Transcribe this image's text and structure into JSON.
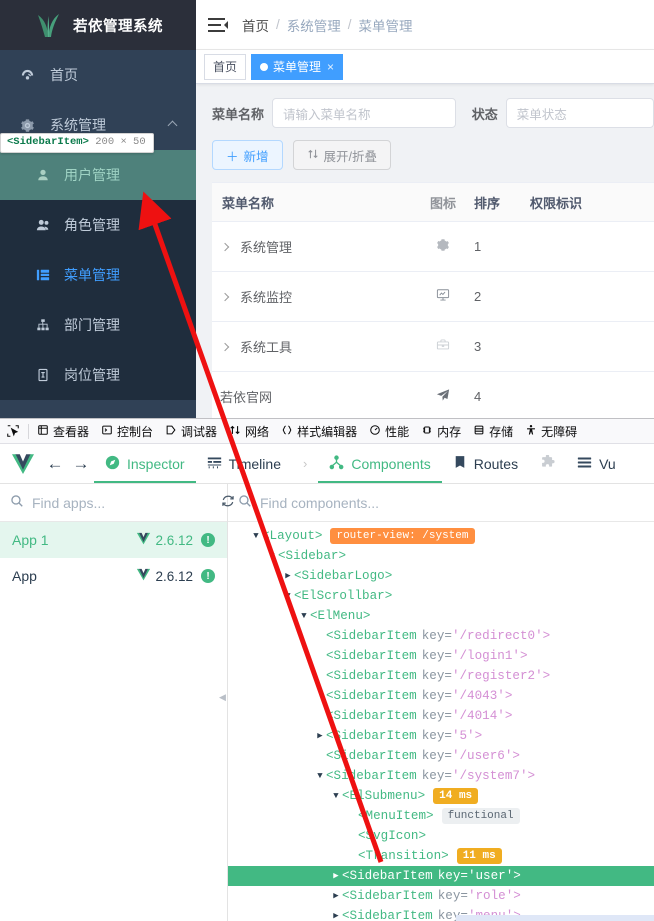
{
  "sidebar": {
    "logo_title": "若依管理系统",
    "logo_icon": "grass-logo-icon",
    "items": [
      {
        "label": "首页",
        "icon": "dashboard-icon",
        "state": "normal"
      },
      {
        "label": "系统管理",
        "icon": "gear-icon",
        "state": "group-open"
      },
      {
        "label": "用户管理",
        "icon": "user-icon",
        "state": "inspect-highlight"
      },
      {
        "label": "角色管理",
        "icon": "peoples-icon",
        "state": "normal"
      },
      {
        "label": "菜单管理",
        "icon": "tree-table-icon",
        "state": "active"
      },
      {
        "label": "部门管理",
        "icon": "tree-icon",
        "state": "normal"
      },
      {
        "label": "岗位管理",
        "icon": "post-icon",
        "state": "normal"
      }
    ]
  },
  "inspect_tooltip": {
    "component": "<SidebarItem>",
    "dimensions": "200 × 50"
  },
  "navbar": {
    "hamburger_icon": "hamburger-icon",
    "breadcrumb": [
      "首页",
      "系统管理",
      "菜单管理"
    ],
    "separator": "/"
  },
  "tags_view": {
    "tabs": [
      {
        "label": "首页",
        "active": false,
        "closable": false
      },
      {
        "label": "菜单管理",
        "active": true,
        "closable": true
      }
    ],
    "close_glyph": "×"
  },
  "filters": {
    "name_label": "菜单名称",
    "name_placeholder": "请输入菜单名称",
    "status_label": "状态",
    "status_placeholder": "菜单状态"
  },
  "toolbar": {
    "add_label": "新增",
    "add_icon": "plus-icon",
    "expand_label": "展开/折叠",
    "expand_icon": "sort-icon"
  },
  "table": {
    "columns": [
      "菜单名称",
      "图标",
      "排序",
      "权限标识"
    ],
    "rows": [
      {
        "name": "系统管理",
        "icon": "gear-icon",
        "sort": "1",
        "perm": "",
        "expandable": true
      },
      {
        "name": "系统监控",
        "icon": "monitor-icon",
        "sort": "2",
        "perm": "",
        "expandable": true
      },
      {
        "name": "系统工具",
        "icon": "tool-icon",
        "sort": "3",
        "perm": "",
        "expandable": true
      },
      {
        "name": "若依官网",
        "icon": "guide-icon",
        "sort": "4",
        "perm": "",
        "expandable": false
      }
    ]
  },
  "firefox_devtools": {
    "picker_icon": "element-picker-icon",
    "tabs": [
      {
        "label": "查看器",
        "icon": "inspector-icon"
      },
      {
        "label": "控制台",
        "icon": "console-icon"
      },
      {
        "label": "调试器",
        "icon": "debugger-icon"
      },
      {
        "label": "网络",
        "icon": "network-icon"
      },
      {
        "label": "样式编辑器",
        "icon": "style-editor-icon"
      },
      {
        "label": "性能",
        "icon": "performance-icon"
      },
      {
        "label": "内存",
        "icon": "memory-icon"
      },
      {
        "label": "存储",
        "icon": "storage-icon"
      },
      {
        "label": "无障碍",
        "icon": "accessibility-icon"
      }
    ]
  },
  "vue_devtools": {
    "logo_icon": "vue-logo-icon",
    "back_icon": "arrow-left-icon",
    "forward_icon": "arrow-right-icon",
    "tabs": [
      {
        "label": "Inspector",
        "icon": "compass-icon",
        "selected": true
      },
      {
        "label": "Timeline",
        "icon": "timeline-icon",
        "selected": false
      },
      {
        "label": "Components",
        "icon": "components-icon",
        "selected": true
      },
      {
        "label": "Routes",
        "icon": "book-icon",
        "selected": false
      },
      {
        "label": "Vu",
        "icon": "list-icon",
        "selected": false
      }
    ],
    "chevron": "›",
    "puzzle_icon": "puzzle-icon",
    "apps_panel": {
      "search_placeholder": "Find apps...",
      "refresh_icon": "refresh-icon",
      "search_icon": "search-icon",
      "apps": [
        {
          "name": "App 1",
          "version": "2.6.12",
          "selected": true
        },
        {
          "name": "App",
          "version": "2.6.12",
          "selected": false
        }
      ]
    },
    "tree_panel": {
      "search_placeholder": "Find components...",
      "search_icon": "search-icon",
      "nodes": [
        {
          "indent": 1,
          "tri": "down",
          "tag": "<Layout>",
          "key": "",
          "pill": "router-view: /system",
          "pill_type": "router",
          "selected": false
        },
        {
          "indent": 2,
          "tri": "down",
          "tag": "<Sidebar>",
          "key": "",
          "pill": "",
          "pill_type": "",
          "selected": false
        },
        {
          "indent": 3,
          "tri": "right",
          "tag": "<SidebarLogo>",
          "key": "",
          "pill": "",
          "pill_type": "",
          "selected": false
        },
        {
          "indent": 3,
          "tri": "down",
          "tag": "<ElScrollbar>",
          "key": "",
          "pill": "",
          "pill_type": "",
          "selected": false
        },
        {
          "indent": 4,
          "tri": "down",
          "tag": "<ElMenu>",
          "key": "",
          "pill": "",
          "pill_type": "",
          "selected": false
        },
        {
          "indent": 5,
          "tri": "none",
          "tag": "<SidebarItem",
          "key": "'/redirect0'",
          "pill": "",
          "pill_type": "",
          "selected": false
        },
        {
          "indent": 5,
          "tri": "none",
          "tag": "<SidebarItem",
          "key": "'/login1'",
          "pill": "",
          "pill_type": "",
          "selected": false
        },
        {
          "indent": 5,
          "tri": "none",
          "tag": "<SidebarItem",
          "key": "'/register2'",
          "pill": "",
          "pill_type": "",
          "selected": false
        },
        {
          "indent": 5,
          "tri": "none",
          "tag": "<SidebarItem",
          "key": "'/4043'",
          "pill": "",
          "pill_type": "",
          "selected": false
        },
        {
          "indent": 5,
          "tri": "none",
          "tag": "<SidebarItem",
          "key": "'/4014'",
          "pill": "",
          "pill_type": "",
          "selected": false
        },
        {
          "indent": 5,
          "tri": "right",
          "tag": "<SidebarItem",
          "key": "'5'",
          "pill": "",
          "pill_type": "",
          "selected": false
        },
        {
          "indent": 5,
          "tri": "none",
          "tag": "<SidebarItem",
          "key": "'/user6'",
          "pill": "",
          "pill_type": "",
          "selected": false
        },
        {
          "indent": 5,
          "tri": "down",
          "tag": "<SidebarItem",
          "key": "'/system7'",
          "pill": "",
          "pill_type": "",
          "selected": false
        },
        {
          "indent": 6,
          "tri": "down",
          "tag": "<ElSubmenu>",
          "key": "",
          "pill": "14 ms",
          "pill_type": "time",
          "selected": false
        },
        {
          "indent": 7,
          "tri": "none",
          "tag": "<MenuItem>",
          "key": "",
          "pill": "functional",
          "pill_type": "func",
          "selected": false
        },
        {
          "indent": 7,
          "tri": "none",
          "tag": "<SvgIcon>",
          "key": "",
          "pill": "",
          "pill_type": "",
          "selected": false
        },
        {
          "indent": 7,
          "tri": "none",
          "tag": "<Transition>",
          "key": "",
          "pill": "11 ms",
          "pill_type": "time",
          "selected": false
        },
        {
          "indent": 6,
          "tri": "right",
          "tag": "<SidebarItem",
          "key": "'user'",
          "pill": "",
          "pill_type": "",
          "selected": true
        },
        {
          "indent": 6,
          "tri": "right",
          "tag": "<SidebarItem",
          "key": "'role'",
          "pill": "",
          "pill_type": "",
          "selected": false
        },
        {
          "indent": 6,
          "tri": "right",
          "tag": "<SidebarItem",
          "key": "'menu'",
          "pill": "",
          "pill_type": "",
          "selected": false
        }
      ]
    }
  },
  "annotation": {
    "arrow_color": "#ee1111"
  }
}
